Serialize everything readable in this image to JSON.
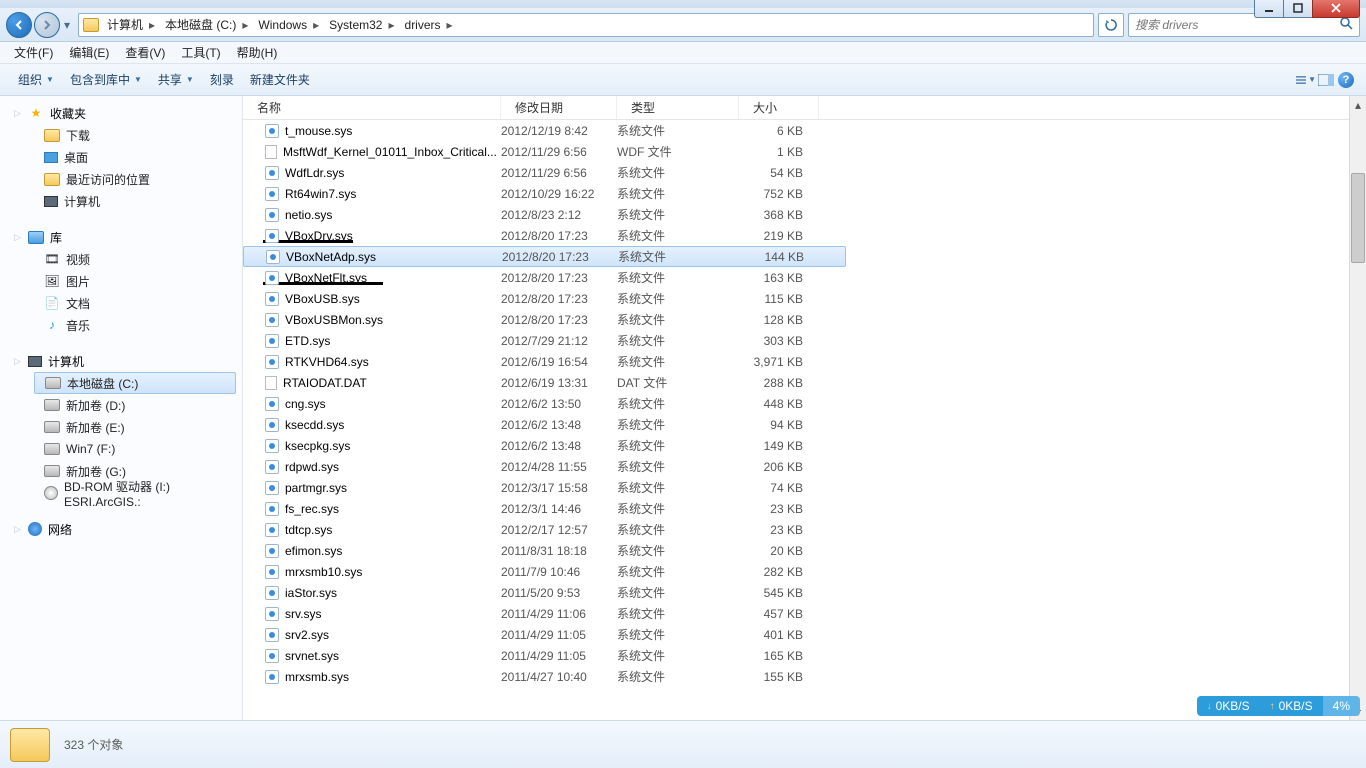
{
  "breadcrumb": [
    "计算机",
    "本地磁盘 (C:)",
    "Windows",
    "System32",
    "drivers"
  ],
  "search": {
    "placeholder": "搜索 drivers"
  },
  "menus": {
    "file": "文件(F)",
    "edit": "编辑(E)",
    "view": "查看(V)",
    "tools": "工具(T)",
    "help": "帮助(H)"
  },
  "toolbar": {
    "organize": "组织",
    "include": "包含到库中",
    "share": "共享",
    "burn": "刻录",
    "newfolder": "新建文件夹"
  },
  "columns": {
    "name": "名称",
    "date": "修改日期",
    "type": "类型",
    "size": "大小"
  },
  "sidebar": {
    "fav": {
      "head": "收藏夹",
      "downloads": "下载",
      "desktop": "桌面",
      "recent": "最近访问的位置",
      "computer": "计算机"
    },
    "lib": {
      "head": "库",
      "video": "视频",
      "pictures": "图片",
      "docs": "文档",
      "music": "音乐"
    },
    "comp": {
      "head": "计算机",
      "c": "本地磁盘 (C:)",
      "d": "新加卷 (D:)",
      "e": "新加卷 (E:)",
      "f": "Win7 (F:)",
      "g": "新加卷 (G:)",
      "bd": "BD-ROM 驱动器 (I:) ESRI.ArcGIS.:"
    },
    "net": {
      "head": "网络"
    }
  },
  "files": [
    {
      "name": "t_mouse.sys",
      "date": "2012/12/19 8:42",
      "type": "系统文件",
      "size": "6 KB",
      "ico": "sys"
    },
    {
      "name": "MsftWdf_Kernel_01011_Inbox_Critical...",
      "date": "2012/11/29 6:56",
      "type": "WDF 文件",
      "size": "1 KB",
      "ico": "doc"
    },
    {
      "name": "WdfLdr.sys",
      "date": "2012/11/29 6:56",
      "type": "系统文件",
      "size": "54 KB",
      "ico": "sys"
    },
    {
      "name": "Rt64win7.sys",
      "date": "2012/10/29 16:22",
      "type": "系统文件",
      "size": "752 KB",
      "ico": "sys"
    },
    {
      "name": "netio.sys",
      "date": "2012/8/23 2:12",
      "type": "系统文件",
      "size": "368 KB",
      "ico": "sys"
    },
    {
      "name": "VBoxDrv.sys",
      "date": "2012/8/20 17:23",
      "type": "系统文件",
      "size": "219 KB",
      "ico": "sys"
    },
    {
      "name": "VBoxNetAdp.sys",
      "date": "2012/8/20 17:23",
      "type": "系统文件",
      "size": "144 KB",
      "ico": "sys",
      "selected": true
    },
    {
      "name": "VBoxNetFlt.sys",
      "date": "2012/8/20 17:23",
      "type": "系统文件",
      "size": "163 KB",
      "ico": "sys"
    },
    {
      "name": "VBoxUSB.sys",
      "date": "2012/8/20 17:23",
      "type": "系统文件",
      "size": "115 KB",
      "ico": "sys"
    },
    {
      "name": "VBoxUSBMon.sys",
      "date": "2012/8/20 17:23",
      "type": "系统文件",
      "size": "128 KB",
      "ico": "sys"
    },
    {
      "name": "ETD.sys",
      "date": "2012/7/29 21:12",
      "type": "系统文件",
      "size": "303 KB",
      "ico": "sys"
    },
    {
      "name": "RTKVHD64.sys",
      "date": "2012/6/19 16:54",
      "type": "系统文件",
      "size": "3,971 KB",
      "ico": "sys"
    },
    {
      "name": "RTAIODAT.DAT",
      "date": "2012/6/19 13:31",
      "type": "DAT 文件",
      "size": "288 KB",
      "ico": "doc"
    },
    {
      "name": "cng.sys",
      "date": "2012/6/2 13:50",
      "type": "系统文件",
      "size": "448 KB",
      "ico": "sys"
    },
    {
      "name": "ksecdd.sys",
      "date": "2012/6/2 13:48",
      "type": "系统文件",
      "size": "94 KB",
      "ico": "sys"
    },
    {
      "name": "ksecpkg.sys",
      "date": "2012/6/2 13:48",
      "type": "系统文件",
      "size": "149 KB",
      "ico": "sys"
    },
    {
      "name": "rdpwd.sys",
      "date": "2012/4/28 11:55",
      "type": "系统文件",
      "size": "206 KB",
      "ico": "sys"
    },
    {
      "name": "partmgr.sys",
      "date": "2012/3/17 15:58",
      "type": "系统文件",
      "size": "74 KB",
      "ico": "sys"
    },
    {
      "name": "fs_rec.sys",
      "date": "2012/3/1 14:46",
      "type": "系统文件",
      "size": "23 KB",
      "ico": "sys"
    },
    {
      "name": "tdtcp.sys",
      "date": "2012/2/17 12:57",
      "type": "系统文件",
      "size": "23 KB",
      "ico": "sys"
    },
    {
      "name": "efimon.sys",
      "date": "2011/8/31 18:18",
      "type": "系统文件",
      "size": "20 KB",
      "ico": "sys"
    },
    {
      "name": "mrxsmb10.sys",
      "date": "2011/7/9 10:46",
      "type": "系统文件",
      "size": "282 KB",
      "ico": "sys"
    },
    {
      "name": "iaStor.sys",
      "date": "2011/5/20 9:53",
      "type": "系统文件",
      "size": "545 KB",
      "ico": "sys"
    },
    {
      "name": "srv.sys",
      "date": "2011/4/29 11:06",
      "type": "系统文件",
      "size": "457 KB",
      "ico": "sys"
    },
    {
      "name": "srv2.sys",
      "date": "2011/4/29 11:05",
      "type": "系统文件",
      "size": "401 KB",
      "ico": "sys"
    },
    {
      "name": "srvnet.sys",
      "date": "2011/4/29 11:05",
      "type": "系统文件",
      "size": "165 KB",
      "ico": "sys"
    },
    {
      "name": "mrxsmb.sys",
      "date": "2011/4/27 10:40",
      "type": "系统文件",
      "size": "155 KB",
      "ico": "sys"
    }
  ],
  "status": {
    "count": "323 个对象"
  },
  "netwidget": {
    "down": "0KB/S",
    "up": "0KB/S",
    "pct": "4%"
  }
}
